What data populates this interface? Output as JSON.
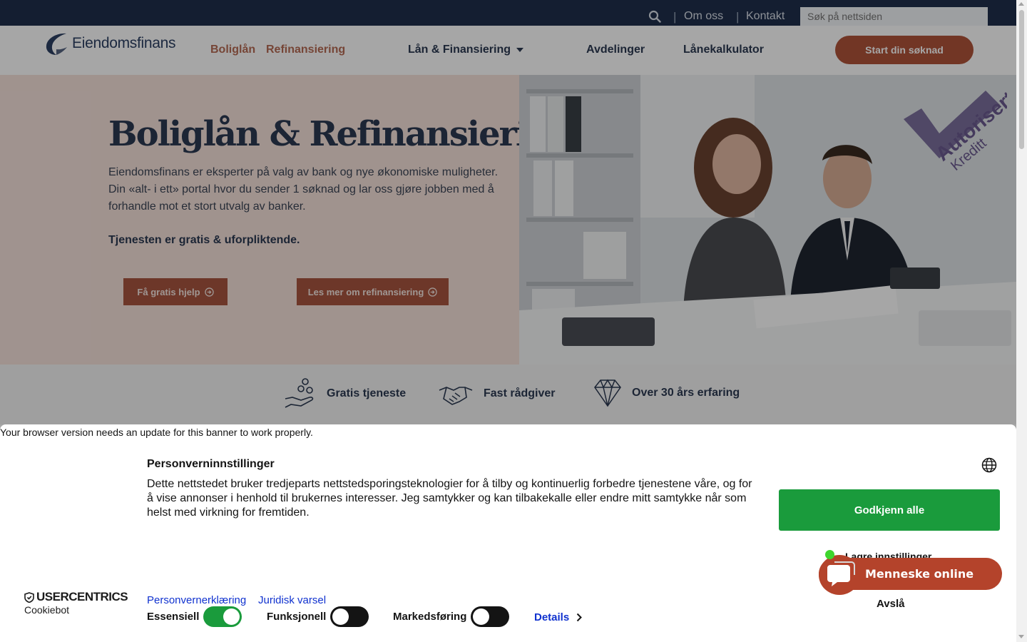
{
  "topbar": {
    "om_oss": "Om oss",
    "kontakt": "Kontakt",
    "search_placeholder": "Søk på nettsiden",
    "separator": "|"
  },
  "nav": {
    "logo_text": "Eiendomsfinans",
    "items": [
      "Boliglån",
      "Refinansiering",
      "Lån & Finansiering",
      "Avdelinger",
      "Lånekalkulator"
    ],
    "cta": "Start din søknad"
  },
  "hero": {
    "title": "Boliglån & Refinansiering",
    "text": "Eiendomsfinans er eksperter på valg av bank og nye økonomiske muligheter. Din «alt- i ett» portal hvor du sender 1 søknad og lar oss gjøre jobben med å forhandle mot et stort utvalg av banker.",
    "strong": "Tjenesten er gratis & uforpliktende.",
    "btn_help": "Få gratis hjelp",
    "btn_more": "Les mer om refinansiering",
    "badge_line1": "Autorisert",
    "badge_line2": "Kreditt"
  },
  "features": [
    {
      "label": "Gratis tjeneste",
      "icon": "hand-coins-icon"
    },
    {
      "label": "Fast rådgiver",
      "icon": "handshake-icon"
    },
    {
      "label": "Over 30 års erfaring",
      "icon": "diamond-icon"
    }
  ],
  "cookie": {
    "warning": "Your browser version needs an update for this banner to work properly.",
    "title": "Personverninnstillinger",
    "text": "Dette nettstedet bruker tredjeparts nettstedsporingsteknologier for å tilby og kontinuerlig forbedre tjenestene våre, og for å vise annonser i henhold til brukernes interesser. Jeg samtykker og kan tilbakekalle eller endre mitt samtykke når som helst med virkning for fremtiden.",
    "accept_all": "Godkjenn alle",
    "save_settings": "Lagre innstillinger",
    "deny": "Avslå",
    "privacy_link": "Personvernerklæring",
    "legal_link": "Juridisk varsel",
    "toggles": [
      {
        "label": "Essensiell",
        "on": true
      },
      {
        "label": "Funksjonell",
        "on": false
      },
      {
        "label": "Markedsføring",
        "on": false
      }
    ],
    "details": "Details",
    "brand": "USERCENTRICS",
    "brand_sub": "Cookiebot"
  },
  "chat": {
    "label": "Menneske online"
  },
  "colors": {
    "navy": "#1f2f4c",
    "brown": "#b0533a",
    "hero_bg": "#f6e2db",
    "accept_green": "#1a9b3c",
    "link_blue": "#1032cf"
  }
}
